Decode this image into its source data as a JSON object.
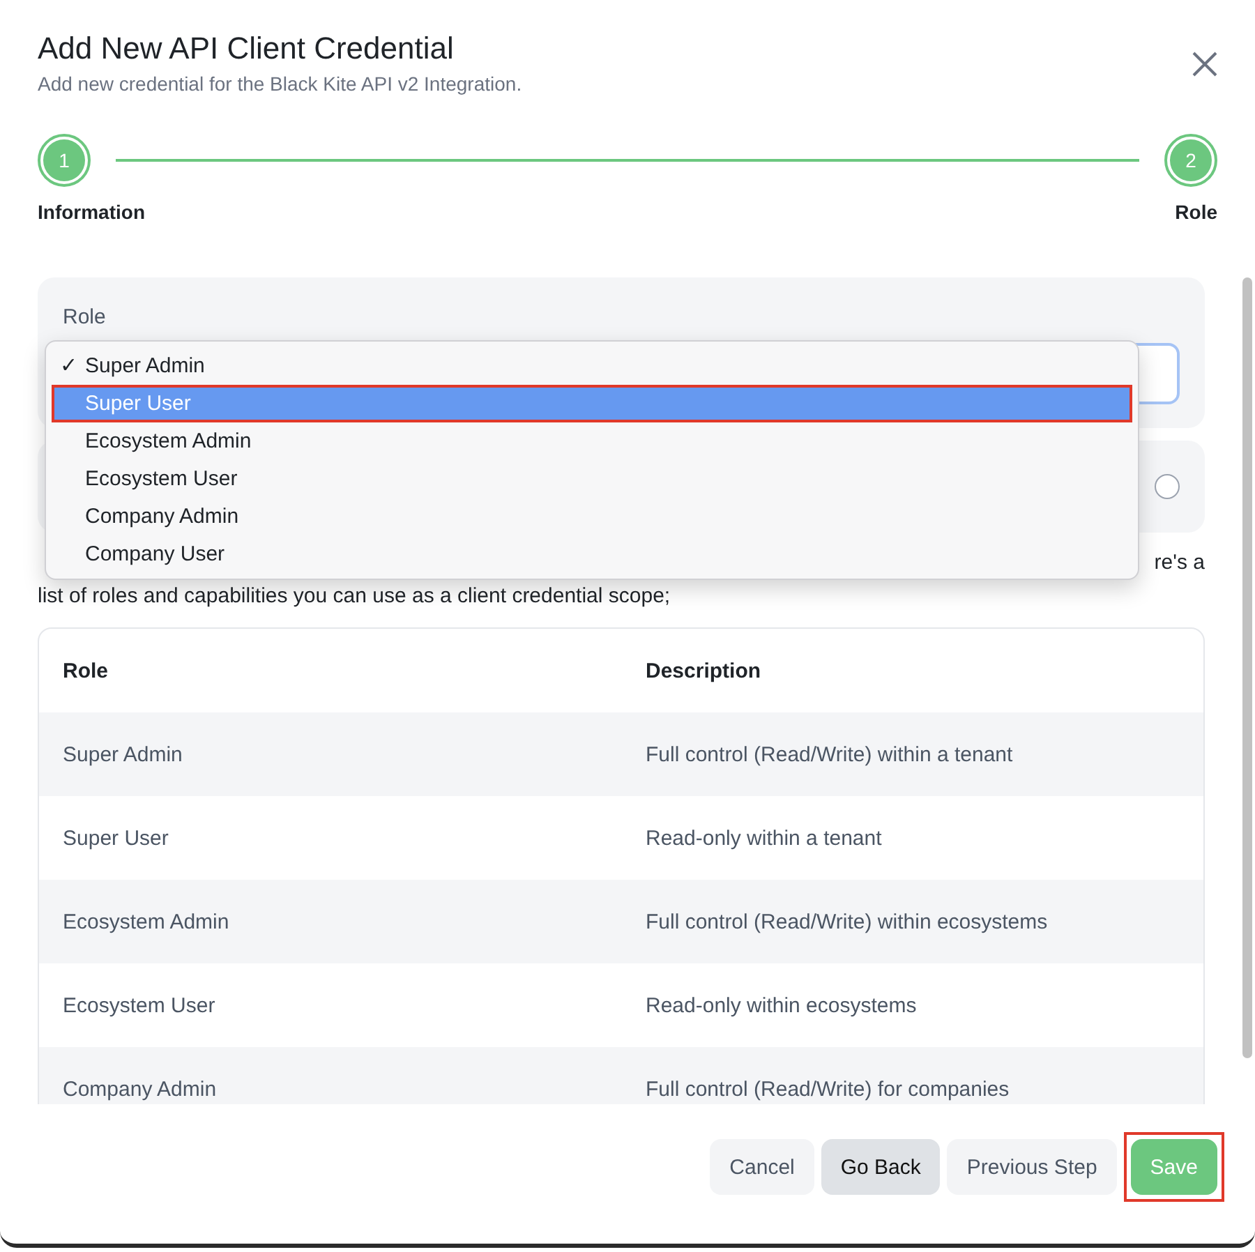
{
  "dialog": {
    "title": "Add New API Client Credential",
    "subtitle": "Add new credential for the Black Kite API v2 Integration."
  },
  "steps": [
    {
      "number": "1",
      "label": "Information",
      "done": true
    },
    {
      "number": "2",
      "label": "Role",
      "done": true
    }
  ],
  "role_field": {
    "label": "Role"
  },
  "role_menu": [
    {
      "label": "Super Admin",
      "checked": true,
      "selected": false,
      "annotated": false
    },
    {
      "label": "Super User",
      "checked": false,
      "selected": true,
      "annotated": true
    },
    {
      "label": "Ecosystem Admin",
      "checked": false,
      "selected": false,
      "annotated": false
    },
    {
      "label": "Ecosystem User",
      "checked": false,
      "selected": false,
      "annotated": false
    },
    {
      "label": "Company Admin",
      "checked": false,
      "selected": false,
      "annotated": false
    },
    {
      "label": "Company User",
      "checked": false,
      "selected": false,
      "annotated": false
    }
  ],
  "check_mark": "✓",
  "intro": {
    "line_end": "re's a",
    "line": "list of roles and capabilities you can use as a client credential scope;"
  },
  "table": {
    "columns": [
      "Role",
      "Description"
    ],
    "rows": [
      [
        "Super Admin",
        "Full control (Read/Write) within a tenant"
      ],
      [
        "Super User",
        "Read-only within a tenant"
      ],
      [
        "Ecosystem Admin",
        "Full control (Read/Write) within ecosystems"
      ],
      [
        "Ecosystem User",
        "Read-only within ecosystems"
      ],
      [
        "Company Admin",
        "Full control (Read/Write) for companies"
      ]
    ]
  },
  "buttons": [
    {
      "label": "Cancel",
      "kind": "light",
      "annotated": false
    },
    {
      "label": "Go Back",
      "kind": "gray",
      "annotated": false
    },
    {
      "label": "Previous Step",
      "kind": "light",
      "annotated": false
    },
    {
      "label": "Save",
      "kind": "primary",
      "annotated": true
    }
  ]
}
